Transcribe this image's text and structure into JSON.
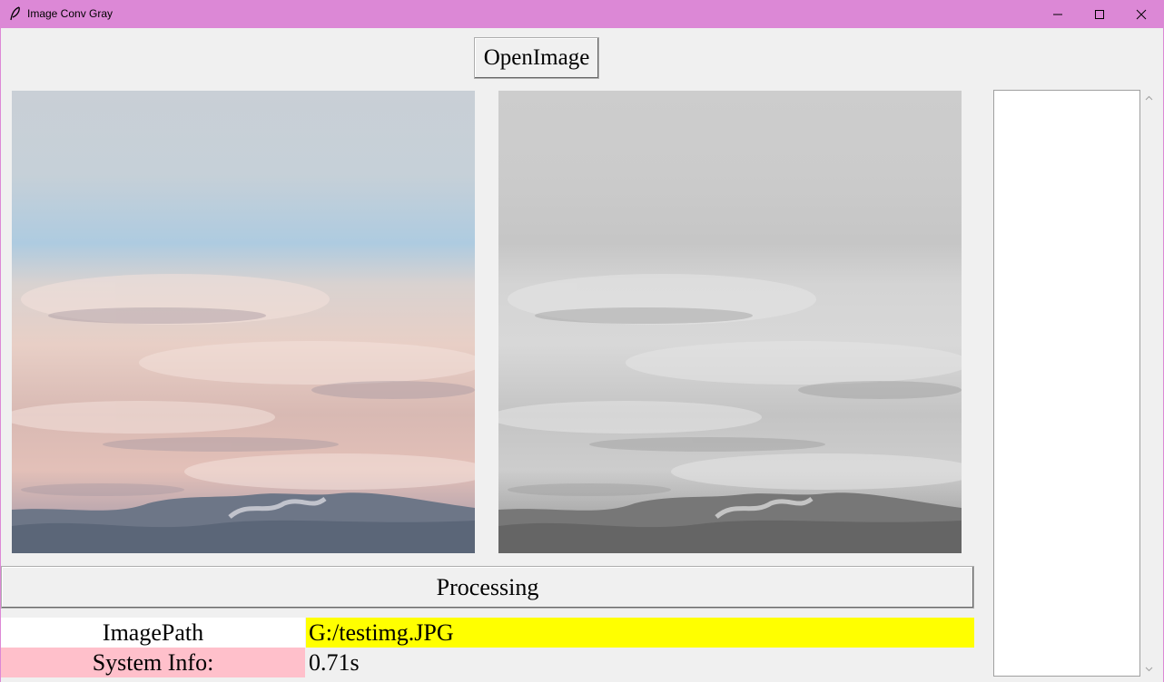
{
  "window": {
    "title": "Image Conv Gray",
    "accent_color": "#dc88d6",
    "controls": {
      "minimize": "minimize-icon",
      "maximize": "maximize-icon",
      "close": "close-icon"
    }
  },
  "toolbar": {
    "open_label": "OpenImage"
  },
  "images": {
    "original": "color-landscape-image",
    "grayscale": "grayscale-landscape-image"
  },
  "actions": {
    "process_label": "Processing"
  },
  "info": {
    "path_label": "ImagePath",
    "path_value": "G:/testimg.JPG",
    "path_highlight": "#ffff00",
    "system_label": "System Info:",
    "system_value": "0.71s",
    "system_label_color": "#ffc0cb"
  }
}
